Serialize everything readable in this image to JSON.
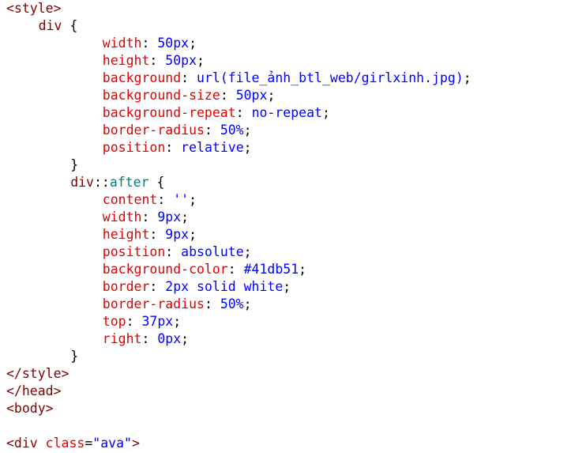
{
  "colors": {
    "tag": "#800000",
    "selector": "#800000",
    "pseudo": "#008080",
    "property": "#e50000",
    "value": "#0000ff",
    "attr": "#e50000",
    "string": "#0000ff",
    "punct": "#000000"
  },
  "code_lines": [
    {
      "indent": 0,
      "tokens": [
        {
          "text": "<style>",
          "type": "tag"
        }
      ]
    },
    {
      "indent": 4,
      "tokens": [
        {
          "text": "div",
          "type": "selector"
        },
        {
          "text": " {",
          "type": "punct"
        }
      ]
    },
    {
      "indent": 12,
      "tokens": [
        {
          "text": "width",
          "type": "property"
        },
        {
          "text": ": ",
          "type": "punct"
        },
        {
          "text": "50px",
          "type": "value"
        },
        {
          "text": ";",
          "type": "punct"
        }
      ]
    },
    {
      "indent": 12,
      "tokens": [
        {
          "text": "height",
          "type": "property"
        },
        {
          "text": ": ",
          "type": "punct"
        },
        {
          "text": "50px",
          "type": "value"
        },
        {
          "text": ";",
          "type": "punct"
        }
      ]
    },
    {
      "indent": 12,
      "tokens": [
        {
          "text": "background",
          "type": "property"
        },
        {
          "text": ": ",
          "type": "punct"
        },
        {
          "text": "url(file_ảnh_btl_web/girlxinh.jpg)",
          "type": "value"
        },
        {
          "text": ";",
          "type": "punct"
        }
      ]
    },
    {
      "indent": 12,
      "tokens": [
        {
          "text": "background-size",
          "type": "property"
        },
        {
          "text": ": ",
          "type": "punct"
        },
        {
          "text": "50px",
          "type": "value"
        },
        {
          "text": ";",
          "type": "punct"
        }
      ]
    },
    {
      "indent": 12,
      "tokens": [
        {
          "text": "background-repeat",
          "type": "property"
        },
        {
          "text": ": ",
          "type": "punct"
        },
        {
          "text": "no-repeat",
          "type": "value"
        },
        {
          "text": ";",
          "type": "punct"
        }
      ]
    },
    {
      "indent": 12,
      "tokens": [
        {
          "text": "border-radius",
          "type": "property"
        },
        {
          "text": ": ",
          "type": "punct"
        },
        {
          "text": "50%",
          "type": "value"
        },
        {
          "text": ";",
          "type": "punct"
        }
      ]
    },
    {
      "indent": 12,
      "tokens": [
        {
          "text": "position",
          "type": "property"
        },
        {
          "text": ": ",
          "type": "punct"
        },
        {
          "text": "relative",
          "type": "value"
        },
        {
          "text": ";",
          "type": "punct"
        }
      ]
    },
    {
      "indent": 8,
      "tokens": [
        {
          "text": "}",
          "type": "punct"
        }
      ]
    },
    {
      "indent": 8,
      "tokens": [
        {
          "text": "div",
          "type": "selector"
        },
        {
          "text": "::",
          "type": "punct"
        },
        {
          "text": "after",
          "type": "pseudo"
        },
        {
          "text": " {",
          "type": "punct"
        }
      ]
    },
    {
      "indent": 12,
      "tokens": [
        {
          "text": "content",
          "type": "property"
        },
        {
          "text": ": ",
          "type": "punct"
        },
        {
          "text": "''",
          "type": "value"
        },
        {
          "text": ";",
          "type": "punct"
        }
      ]
    },
    {
      "indent": 12,
      "tokens": [
        {
          "text": "width",
          "type": "property"
        },
        {
          "text": ": ",
          "type": "punct"
        },
        {
          "text": "9px",
          "type": "value"
        },
        {
          "text": ";",
          "type": "punct"
        }
      ]
    },
    {
      "indent": 12,
      "tokens": [
        {
          "text": "height",
          "type": "property"
        },
        {
          "text": ": ",
          "type": "punct"
        },
        {
          "text": "9px",
          "type": "value"
        },
        {
          "text": ";",
          "type": "punct"
        }
      ]
    },
    {
      "indent": 12,
      "tokens": [
        {
          "text": "position",
          "type": "property"
        },
        {
          "text": ": ",
          "type": "punct"
        },
        {
          "text": "absolute",
          "type": "value"
        },
        {
          "text": ";",
          "type": "punct"
        }
      ]
    },
    {
      "indent": 12,
      "tokens": [
        {
          "text": "background-color",
          "type": "property"
        },
        {
          "text": ": ",
          "type": "punct"
        },
        {
          "text": "#41db51",
          "type": "value"
        },
        {
          "text": ";",
          "type": "punct"
        }
      ]
    },
    {
      "indent": 12,
      "tokens": [
        {
          "text": "border",
          "type": "property"
        },
        {
          "text": ": ",
          "type": "punct"
        },
        {
          "text": "2px solid white",
          "type": "value"
        },
        {
          "text": ";",
          "type": "punct"
        }
      ]
    },
    {
      "indent": 12,
      "tokens": [
        {
          "text": "border-radius",
          "type": "property"
        },
        {
          "text": ": ",
          "type": "punct"
        },
        {
          "text": "50%",
          "type": "value"
        },
        {
          "text": ";",
          "type": "punct"
        }
      ]
    },
    {
      "indent": 12,
      "tokens": [
        {
          "text": "top",
          "type": "property"
        },
        {
          "text": ": ",
          "type": "punct"
        },
        {
          "text": "37px",
          "type": "value"
        },
        {
          "text": ";",
          "type": "punct"
        }
      ]
    },
    {
      "indent": 12,
      "tokens": [
        {
          "text": "right",
          "type": "property"
        },
        {
          "text": ": ",
          "type": "punct"
        },
        {
          "text": "0px",
          "type": "value"
        },
        {
          "text": ";",
          "type": "punct"
        }
      ]
    },
    {
      "indent": 8,
      "tokens": [
        {
          "text": "}",
          "type": "punct"
        }
      ]
    },
    {
      "indent": 0,
      "tokens": [
        {
          "text": "</style>",
          "type": "tag"
        }
      ]
    },
    {
      "indent": 0,
      "tokens": [
        {
          "text": "</head>",
          "type": "tag"
        }
      ]
    },
    {
      "indent": 0,
      "tokens": [
        {
          "text": "<body>",
          "type": "tag"
        }
      ]
    },
    {
      "indent": 0,
      "tokens": []
    },
    {
      "indent": 0,
      "tokens": [
        {
          "text": "<div ",
          "type": "tag"
        },
        {
          "text": "class",
          "type": "attr"
        },
        {
          "text": "=",
          "type": "punct"
        },
        {
          "text": "\"ava\"",
          "type": "string"
        },
        {
          "text": ">",
          "type": "tag"
        }
      ]
    }
  ]
}
